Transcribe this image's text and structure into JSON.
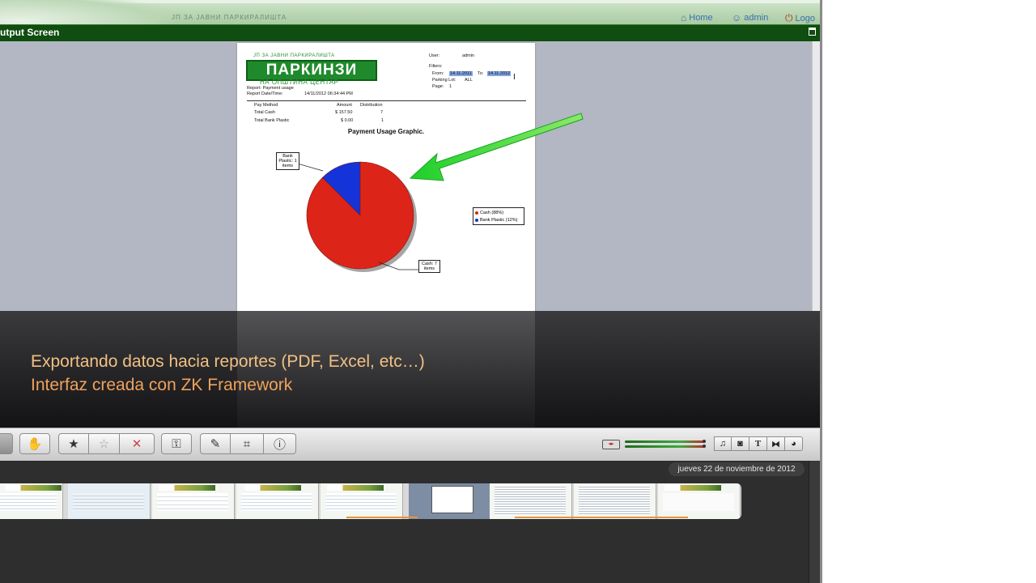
{
  "header": {
    "brand_small": "ЈП ЗА ЈАВНИ ПАРКИРАЛИШТА",
    "links": [
      {
        "icon": "house-icon",
        "label": "Home"
      },
      {
        "icon": "user-icon",
        "label": "admin"
      },
      {
        "icon": "power-icon",
        "label": "Logo"
      }
    ]
  },
  "window": {
    "title": "utput Screen"
  },
  "report": {
    "logo_top": "ЈП ЗА ЈАВНИ ПАРКИРАЛИШТА",
    "logo_main": "ПАРКИНЗИ",
    "logo_sub": "НА ОПШТИНА ЦЕНТАР",
    "report_label": "Report: Payment usage",
    "datetime_label": "Report Date/Time:",
    "datetime_value": "14/11/2012 06:34:44 PM",
    "user_label": "User:",
    "user_value": "admin",
    "filters_label": "Filters:",
    "from_label": "From:",
    "from_value": "14.11.2011",
    "to_label": "To:",
    "to_value": "14.11.2012",
    "parking_label": "Parking Lot:",
    "parking_value": "ALL",
    "page_label": "Page:",
    "page_value": "1",
    "table": {
      "headers": [
        "Pay Method",
        "Amount",
        "Distribution"
      ],
      "rows": [
        [
          "Total Cash",
          "$ 157.50",
          "7"
        ],
        [
          "Total Bank Plastic",
          "$ 0.00",
          "1"
        ]
      ]
    },
    "chart_title": "Payment Usage Graphic.",
    "callout_bank": [
      "Bank",
      "Plastic: 1",
      "items"
    ],
    "callout_cash": [
      "Cash: 7",
      "items"
    ],
    "legend": [
      "Cash (88%)",
      "Bank Plastic (12%)"
    ]
  },
  "chart_data": {
    "type": "pie",
    "title": "Payment Usage Graphic.",
    "categories": [
      "Cash",
      "Bank Plastic"
    ],
    "values": [
      7,
      1
    ],
    "percents": [
      88,
      12
    ],
    "colors": [
      "#dd2418",
      "#1433d9"
    ],
    "legend_position": "right"
  },
  "caption": {
    "line1": "Exportando datos hacia reportes (PDF, Excel, etc…)",
    "line2": "Interfaz creada con ZK Framework"
  },
  "toolbar": {
    "left_buttons": [
      "hand-icon",
      "star-icon",
      "star-outline-icon",
      "x-icon",
      "key-icon",
      "dropper-icon",
      "crop-icon",
      "info-icon"
    ],
    "right_buttons": [
      "music-icon",
      "camera-icon",
      "text-icon",
      "transition-icon",
      "globe-icon"
    ]
  },
  "timeline": {
    "date": "jueves 22 de noviembre de 2012"
  }
}
